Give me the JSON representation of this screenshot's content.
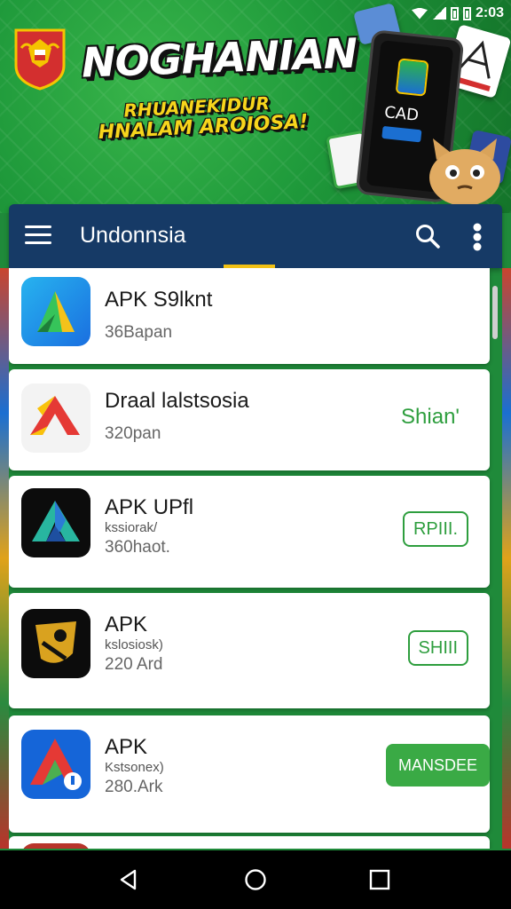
{
  "status": {
    "time": "2:03"
  },
  "banner": {
    "title": "NOGHANIAN",
    "subtitle_line1": "RHUANEKIDUR",
    "subtitle_line2": "HNALAM AROIOSA!",
    "phone_text": "CAD"
  },
  "appbar": {
    "title": "Undonnsia",
    "menu_icon": "menu-icon",
    "search_icon": "search-icon",
    "more_icon": "more-vert-icon"
  },
  "apps": [
    {
      "name": "APK S9lknt",
      "developer": "",
      "size": "36Bapan",
      "action": ""
    },
    {
      "name": "Draal lalstsosia",
      "developer": "",
      "size": "320pan",
      "action": "Shian'"
    },
    {
      "name": "APK UPfl",
      "developer": "kssiorak/",
      "size": "360haot.",
      "action": "RPIII."
    },
    {
      "name": "APK",
      "developer": "kslosiosk)",
      "size": "220 Ard",
      "action": "SHIII"
    },
    {
      "name": "APK",
      "developer": "Kstsonex)",
      "size": "280.Ark",
      "action": "MANSDEE"
    }
  ],
  "colors": {
    "appbar": "#163a66",
    "accent": "#f2c114",
    "green": "#2e9e3e",
    "banner": "#1f9a3b"
  }
}
